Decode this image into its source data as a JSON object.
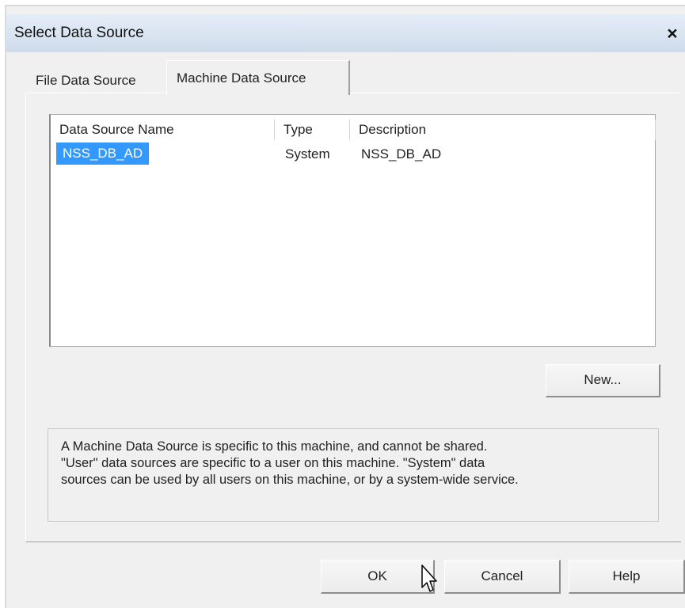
{
  "window": {
    "title": "Select Data Source",
    "close_label": "×"
  },
  "tabs": [
    {
      "label": "File Data Source",
      "active": false
    },
    {
      "label": "Machine Data Source",
      "active": true
    }
  ],
  "list": {
    "columns": [
      "Data Source Name",
      "Type",
      "Description"
    ],
    "rows": [
      {
        "name": "NSS_DB_AD",
        "type": "System",
        "description": "NSS_DB_AD",
        "selected": true
      }
    ]
  },
  "buttons": {
    "new": "New...",
    "ok": "OK",
    "cancel": "Cancel",
    "help": "Help"
  },
  "info": {
    "lines": [
      "A Machine Data Source is specific to this machine, and cannot be shared.",
      "\"User\" data sources are specific to a user on this machine.  \"System\" data",
      "sources can be used by all users on this machine, or by a system-wide service."
    ]
  },
  "colors": {
    "selection": "#3399ff",
    "titlebar": "#d9e4f1",
    "dialog_background": "#f0f0f0"
  }
}
